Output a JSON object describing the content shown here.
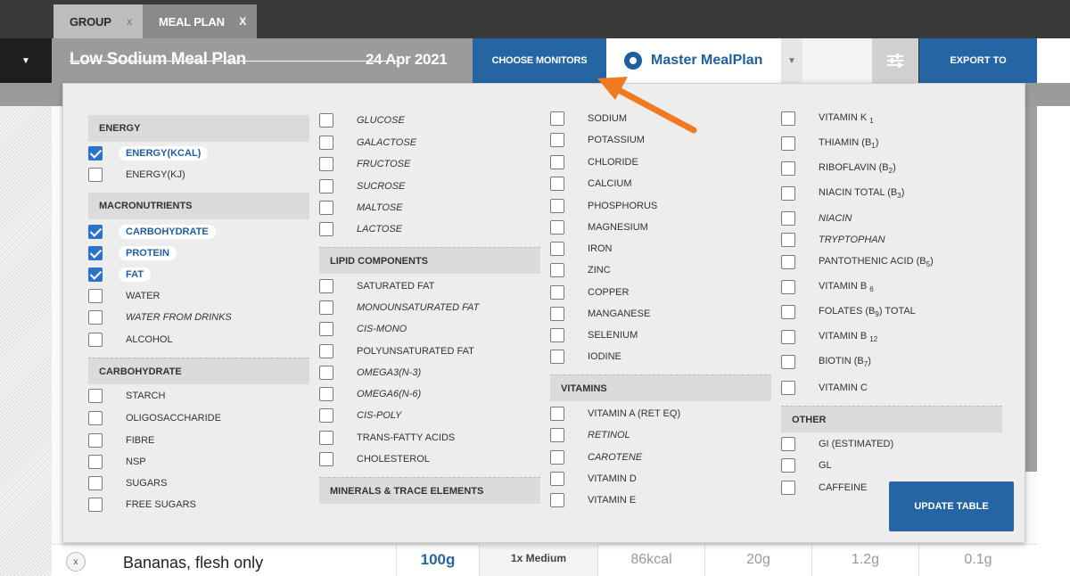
{
  "tabs": [
    {
      "label": "GROUP",
      "close": "x"
    },
    {
      "label": "MEAL PLAN",
      "close": "X"
    }
  ],
  "header": {
    "dropdown_icon": "▼",
    "title": "Low Sodium Meal Plan",
    "date": "24 Apr 2021",
    "choose_monitors": "CHOOSE MONITORS",
    "master_label": "Master MealPlan",
    "master_dropdown": "▼",
    "export_label": "EXPORT TO"
  },
  "food_row": {
    "remove": "x",
    "name": "Bananas, flesh only",
    "amount": "100g",
    "portion": "1x Medium",
    "kcal": "86kcal",
    "carb": "20g",
    "protein": "1.2g",
    "fat": "0.1g"
  },
  "panel": {
    "col1": {
      "energy_header": "ENERGY",
      "energy": [
        {
          "label": "ENERGY(KCAL)",
          "checked": true
        },
        {
          "label": "ENERGY(KJ)",
          "checked": false
        }
      ],
      "macro_header": "MACRONUTRIENTS",
      "macro": [
        {
          "label": "CARBOHYDRATE",
          "checked": true
        },
        {
          "label": "PROTEIN",
          "checked": true
        },
        {
          "label": "FAT",
          "checked": true
        },
        {
          "label": "WATER",
          "checked": false
        },
        {
          "label": "WATER FROM DRINKS",
          "checked": false
        },
        {
          "label": "ALCOHOL",
          "checked": false
        }
      ],
      "carb_header": "CARBOHYDRATE",
      "carb": [
        {
          "label": "STARCH",
          "checked": false
        },
        {
          "label": "OLIGOSACCHARIDE",
          "checked": false
        },
        {
          "label": "FIBRE",
          "checked": false
        },
        {
          "label": "NSP",
          "checked": false
        },
        {
          "label": "SUGARS",
          "checked": false
        },
        {
          "label": "FREE SUGARS",
          "checked": false
        }
      ]
    },
    "col2": {
      "sugars": [
        {
          "label": "GLUCOSE",
          "checked": false
        },
        {
          "label": "GALACTOSE",
          "checked": false
        },
        {
          "label": "FRUCTOSE",
          "checked": false
        },
        {
          "label": "SUCROSE",
          "checked": false
        },
        {
          "label": "MALTOSE",
          "checked": false
        },
        {
          "label": "LACTOSE",
          "checked": false
        }
      ],
      "lipid_header": "LIPID COMPONENTS",
      "lipids": [
        {
          "label": "SATURATED FAT",
          "checked": false
        },
        {
          "label": "MONOUNSATURATED FAT",
          "checked": false
        },
        {
          "label": "CIS-MONO",
          "checked": false
        },
        {
          "label": "POLYUNSATURATED FAT",
          "checked": false
        },
        {
          "label": "OMEGA3(N-3)",
          "checked": false
        },
        {
          "label": "OMEGA6(N-6)",
          "checked": false
        },
        {
          "label": "CIS-POLY",
          "checked": false
        },
        {
          "label": "TRANS-FATTY ACIDS",
          "checked": false
        },
        {
          "label": "CHOLESTEROL",
          "checked": false
        }
      ],
      "minerals_header": "MINERALS & TRACE ELEMENTS"
    },
    "col3": {
      "minerals": [
        {
          "label": "SODIUM",
          "checked": false
        },
        {
          "label": "POTASSIUM",
          "checked": false
        },
        {
          "label": "CHLORIDE",
          "checked": false
        },
        {
          "label": "CALCIUM",
          "checked": false
        },
        {
          "label": "PHOSPHORUS",
          "checked": false
        },
        {
          "label": "MAGNESIUM",
          "checked": false
        },
        {
          "label": "IRON",
          "checked": false
        },
        {
          "label": "ZINC",
          "checked": false
        },
        {
          "label": "COPPER",
          "checked": false
        },
        {
          "label": "MANGANESE",
          "checked": false
        },
        {
          "label": "SELENIUM",
          "checked": false
        },
        {
          "label": "IODINE",
          "checked": false
        }
      ],
      "vitamins_header": "VITAMINS",
      "vitamins": [
        {
          "label": "VITAMIN A (RET EQ)",
          "checked": false
        },
        {
          "label": "RETINOL",
          "checked": false
        },
        {
          "label": "CAROTENE",
          "checked": false
        },
        {
          "label": "VITAMIN D",
          "checked": false
        },
        {
          "label": "VITAMIN E",
          "checked": false
        }
      ]
    },
    "col4": {
      "vitamins": [
        {
          "label": "VITAMIN K",
          "sub": "1",
          "checked": false
        },
        {
          "label": "THIAMIN (B",
          "sub": "1",
          "suffix": ")",
          "checked": false
        },
        {
          "label": "RIBOFLAVIN (B",
          "sub": "2",
          "suffix": ")",
          "checked": false
        },
        {
          "label": "NIACIN TOTAL (B",
          "sub": "3",
          "suffix": ")",
          "checked": false
        },
        {
          "label": "NIACIN",
          "checked": false
        },
        {
          "label": "TRYPTOPHAN",
          "checked": false
        },
        {
          "label": "PANTOTHENIC ACID (B",
          "sub": "5",
          "suffix": ")",
          "checked": false
        },
        {
          "label": "VITAMIN B",
          "sub": "6",
          "checked": false
        },
        {
          "label": "FOLATES (B",
          "sub": "9",
          "suffix": ") TOTAL",
          "checked": false
        },
        {
          "label": "VITAMIN B",
          "sub": "12",
          "checked": false
        },
        {
          "label": "BIOTIN (B",
          "sub": "7",
          "suffix": ")",
          "checked": false
        },
        {
          "label": "VITAMIN C",
          "checked": false
        }
      ],
      "other_header": "OTHER",
      "other": [
        {
          "label": "GI (ESTIMATED)",
          "checked": false
        },
        {
          "label": "GL",
          "checked": false
        },
        {
          "label": "CAFFEINE",
          "checked": false
        }
      ]
    },
    "update_label": "UPDATE TABLE"
  },
  "colors": {
    "accent_blue": "#2565a3",
    "checkbox_blue": "#2b73c7",
    "arrow_orange": "#f07a1f"
  }
}
